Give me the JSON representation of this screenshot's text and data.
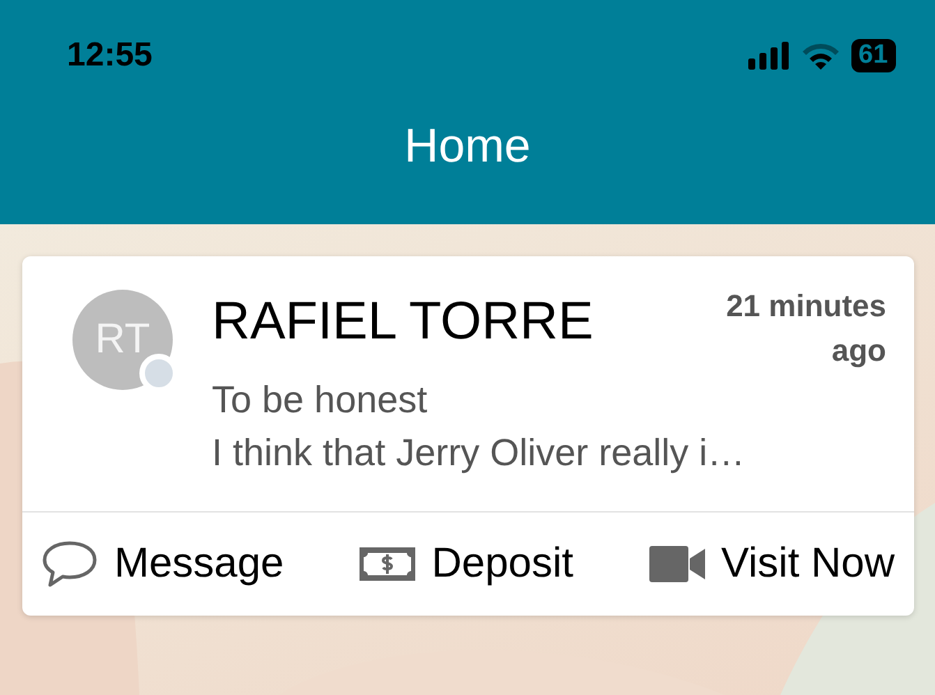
{
  "status_bar": {
    "time": "12:55",
    "battery": "61"
  },
  "header": {
    "title": "Home"
  },
  "card": {
    "initials": "RT",
    "name": "RAFIEL TORRE",
    "time": "21 minutes ago",
    "message_lines": [
      "To be honest",
      "I think that Jerry Oliver really i…"
    ],
    "actions": [
      {
        "kind": "message",
        "label": "Message"
      },
      {
        "kind": "deposit",
        "label": "Deposit"
      },
      {
        "kind": "video",
        "label": "Visit Now"
      }
    ]
  }
}
